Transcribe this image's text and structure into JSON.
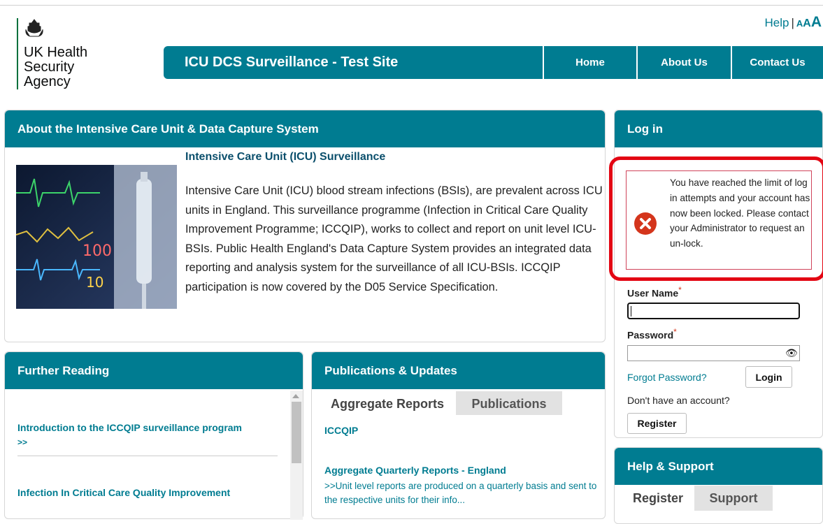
{
  "logo": {
    "lines": [
      "UK Health",
      "Security",
      "Agency"
    ],
    "icon": "royal-crest-icon"
  },
  "help_links": {
    "help": "Help",
    "sep": "|",
    "a_small": "A",
    "a_medium": "A",
    "a_large": "A"
  },
  "header": {
    "title": "ICU DCS Surveillance - Test Site",
    "nav": [
      "Home",
      "About Us",
      "Contact Us"
    ]
  },
  "about": {
    "heading": "About the Intensive Care Unit & Data Capture System",
    "subtitle": "Intensive Care Unit (ICU) Surveillance",
    "body": "Intensive Care Unit (ICU) blood stream infections (BSIs), are prevalent across ICU units in England. This surveillance programme (Infection in Critical Care Quality Improvement Programme; ICCQIP), works to collect and report on unit level ICU-BSIs. Public Health England's Data Capture System provides an integrated data reporting and analysis system for the surveillance of all ICU-BSIs. ICCQIP participation is now covered by the D05 Service Specification."
  },
  "further": {
    "heading": "Further Reading",
    "items": [
      {
        "title": "Introduction to the ICCQIP surveillance program",
        "more": ">>"
      },
      {
        "title": "Infection In Critical Care Quality Improvement",
        "more": ""
      }
    ]
  },
  "pubs": {
    "heading": "Publications & Updates",
    "tabs": [
      "Aggregate Reports",
      "Publications"
    ],
    "section": "ICCQIP",
    "item_title": "Aggregate Quarterly Reports - England",
    "item_desc": ">>Unit level reports are produced on a quarterly basis and sent to the respective units for their info..."
  },
  "login": {
    "heading": "Log in",
    "alert": "You have reached the limit of log in attempts and your account has now been locked. Please contact your Administrator to request an un-lock.",
    "username_label": "User Name",
    "password_label": "Password",
    "required_mark": "*",
    "forgot": "Forgot Password?",
    "login_button": "Login",
    "no_account": "Don't have an account?",
    "register_button": "Register"
  },
  "help_support": {
    "heading": "Help & Support",
    "tabs": [
      "Register",
      "Support"
    ]
  },
  "colors": {
    "brand": "#007c91",
    "alert": "#e30613",
    "error_icon": "#d4351c"
  }
}
